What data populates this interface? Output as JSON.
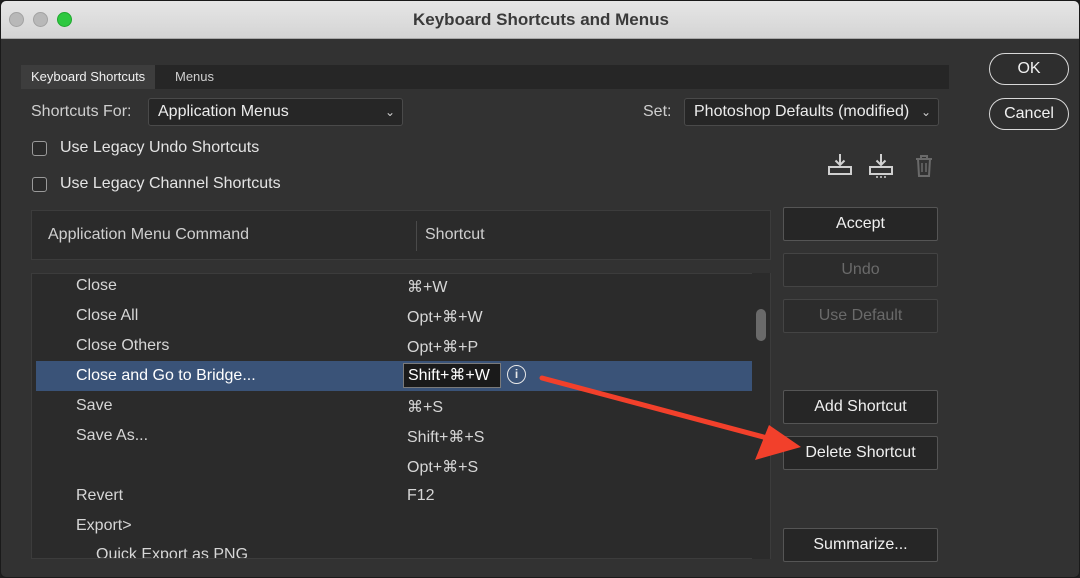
{
  "window": {
    "title": "Keyboard Shortcuts and Menus"
  },
  "tabs": [
    {
      "label": "Keyboard Shortcuts",
      "active": true
    },
    {
      "label": "Menus",
      "active": false
    }
  ],
  "shortcuts_for": {
    "label": "Shortcuts For:",
    "value": "Application Menus"
  },
  "set": {
    "label": "Set:",
    "value": "Photoshop Defaults (modified)"
  },
  "checkboxes": [
    {
      "label": "Use Legacy Undo Shortcuts",
      "checked": false
    },
    {
      "label": "Use Legacy Channel Shortcuts",
      "checked": false
    }
  ],
  "set_icons": [
    "save-set-icon",
    "save-set-as-icon",
    "delete-set-icon"
  ],
  "table": {
    "col_command": "Application Menu Command",
    "col_shortcut": "Shortcut",
    "rows": [
      {
        "command": "Close",
        "shortcut": "⌘+W"
      },
      {
        "command": "Close All",
        "shortcut": "Opt+⌘+W"
      },
      {
        "command": "Close Others",
        "shortcut": "Opt+⌘+P"
      },
      {
        "command": "Close and Go to Bridge...",
        "shortcut": "Shift+⌘+W",
        "selected": true
      },
      {
        "command": "Save",
        "shortcut": "⌘+S"
      },
      {
        "command": "Save As...",
        "shortcut": "Shift+⌘+S"
      },
      {
        "command": "",
        "shortcut": "Opt+⌘+S"
      },
      {
        "command": "Revert",
        "shortcut": "F12"
      },
      {
        "command": "Export>",
        "shortcut": ""
      },
      {
        "command": "Quick Export as PNG",
        "shortcut": ""
      }
    ]
  },
  "side_buttons": {
    "accept": "Accept",
    "undo": "Undo",
    "use_default": "Use Default",
    "add_shortcut": "Add Shortcut",
    "delete_shortcut": "Delete Shortcut",
    "summarize": "Summarize..."
  },
  "dialog_buttons": {
    "ok": "OK",
    "cancel": "Cancel"
  },
  "colors": {
    "accent_arrow": "#f2402b",
    "selection": "#3a5378"
  }
}
